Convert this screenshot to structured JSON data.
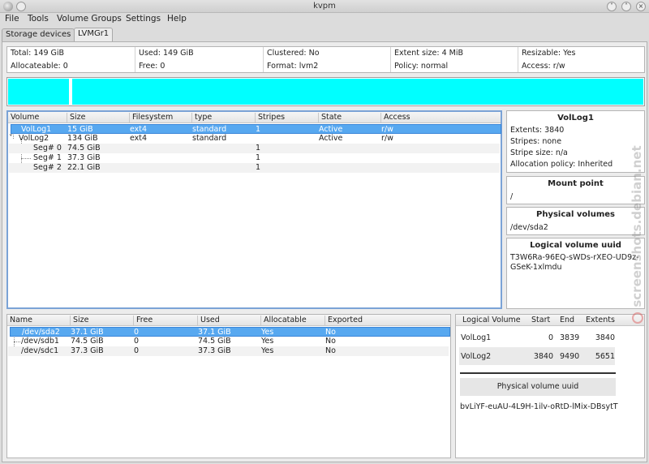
{
  "window": {
    "title": "kvpm"
  },
  "menu": [
    "File",
    "Tools",
    "Volume Groups",
    "Settings",
    "Help"
  ],
  "tabs": [
    "Storage devices",
    "LVMGr1"
  ],
  "summary": {
    "total": "Total: 149 GiB",
    "allocateable": "Allocateable: 0",
    "used": "Used: 149 GiB",
    "free": "Free: 0",
    "clustered": "Clustered: No",
    "format": "Format: lvm2",
    "extent_size": "Extent size: 4 MiB",
    "policy": "Policy: normal",
    "resizable": "Resizable: Yes",
    "access": "Access: r/w"
  },
  "colors": {
    "bar_fill": "#00ffff",
    "selection": "#57a8f0"
  },
  "lv_table": {
    "headers": [
      "Volume",
      "Size",
      "Filesystem",
      "type",
      "Stripes",
      "State",
      "Access"
    ],
    "rows": [
      {
        "volume": "VolLog1",
        "size": "15 GiB",
        "filesystem": "ext4",
        "type": "standard",
        "stripes": "1",
        "state": "Active",
        "access": "r/w"
      },
      {
        "volume": "VolLog2",
        "size": "134 GiB",
        "filesystem": "ext4",
        "type": "standard",
        "stripes": "",
        "state": "Active",
        "access": "r/w"
      },
      {
        "volume": "Seg# 0",
        "size": "74.5 GiB",
        "filesystem": "",
        "type": "",
        "stripes": "1",
        "state": "",
        "access": ""
      },
      {
        "volume": "Seg# 1",
        "size": "37.3 GiB",
        "filesystem": "",
        "type": "",
        "stripes": "1",
        "state": "",
        "access": ""
      },
      {
        "volume": "Seg# 2",
        "size": "22.1 GiB",
        "filesystem": "",
        "type": "",
        "stripes": "1",
        "state": "",
        "access": ""
      }
    ]
  },
  "lv_info": {
    "name": "VolLog1",
    "extents": "Extents: 3840",
    "stripes": "Stripes: none",
    "stripe_size": "Stripe size: n/a",
    "allocation_policy": "Allocation policy: Inherited",
    "mount_point_header": "Mount point",
    "mount_point": "/",
    "pv_header": "Physical volumes",
    "pv": "/dev/sda2",
    "uuid_header": "Logical volume uuid",
    "uuid_line1": "T3W6Ra-96EQ-sWDs-rXEO-UD9z-",
    "uuid_line2": "GSeK-1xlmdu"
  },
  "pv_table": {
    "headers": [
      "Name",
      "Size",
      "Free",
      "Used",
      "Allocatable",
      "Exported"
    ],
    "rows": [
      {
        "name": "/dev/sda2",
        "size": "37.1 GiB",
        "free": "0",
        "used": "37.1 GiB",
        "allocatable": "Yes",
        "exported": "No"
      },
      {
        "name": "/dev/sdb1",
        "size": "74.5 GiB",
        "free": "0",
        "used": "74.5 GiB",
        "allocatable": "Yes",
        "exported": "No"
      },
      {
        "name": "/dev/sdc1",
        "size": "37.3 GiB",
        "free": "0",
        "used": "37.3 GiB",
        "allocatable": "Yes",
        "exported": "No"
      }
    ]
  },
  "pv_lv_table": {
    "headers": [
      "Logical Volume",
      "Start",
      "End",
      "Extents"
    ],
    "rows": [
      {
        "lv": "VolLog1",
        "start": "0",
        "end": "3839",
        "extents": "3840"
      },
      {
        "lv": "VolLog2",
        "start": "3840",
        "end": "9490",
        "extents": "5651"
      }
    ],
    "pv_uuid_header": "Physical volume uuid",
    "pv_uuid": "bvLiYF-euAU-4L9H-1ilv-oRtD-lMix-DBsytT"
  },
  "watermark": "screenshots.debian.net"
}
